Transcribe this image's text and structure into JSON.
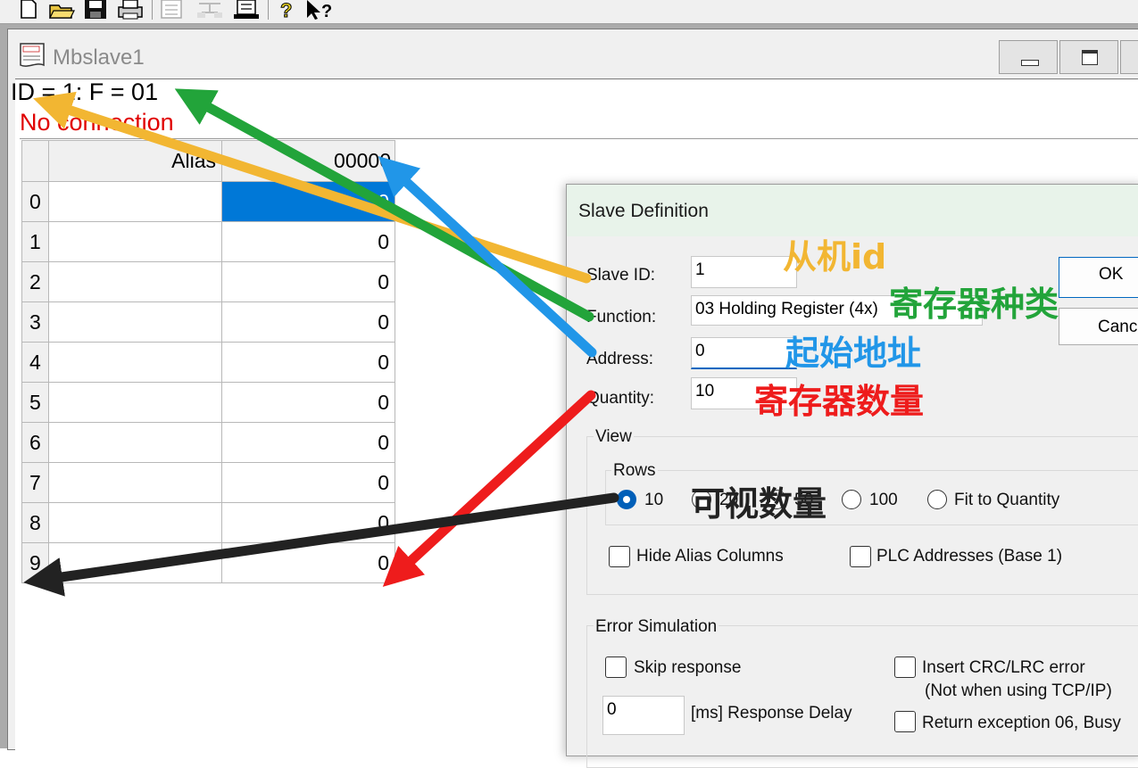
{
  "window": {
    "title": "Mbslave1"
  },
  "status": {
    "id_line": "ID = 1: F = 01",
    "connection": "No connection"
  },
  "grid": {
    "header_alias": "Alias",
    "header_address": "00000",
    "rows": [
      {
        "index": "0",
        "value": "0"
      },
      {
        "index": "1",
        "value": "0"
      },
      {
        "index": "2",
        "value": "0"
      },
      {
        "index": "3",
        "value": "0"
      },
      {
        "index": "4",
        "value": "0"
      },
      {
        "index": "5",
        "value": "0"
      },
      {
        "index": "6",
        "value": "0"
      },
      {
        "index": "7",
        "value": "0"
      },
      {
        "index": "8",
        "value": "0"
      },
      {
        "index": "9",
        "value": "0"
      }
    ]
  },
  "dialog": {
    "title": "Slave Definition",
    "slave_id_label": "Slave ID:",
    "slave_id_value": "1",
    "function_label": "Function:",
    "function_value": "03 Holding Register (4x)",
    "address_label": "Address:",
    "address_value": "0",
    "quantity_label": "Quantity:",
    "quantity_value": "10",
    "ok_label": "OK",
    "cancel_label": "Canc",
    "view_label": "View",
    "rows_label": "Rows",
    "row_options": [
      "10",
      "20",
      "50",
      "100",
      "Fit to Quantity"
    ],
    "row_selected": "10",
    "hide_alias_label": "Hide Alias Columns",
    "plc_addresses_label": "PLC Addresses (Base 1)",
    "error_sim_label": "Error Simulation",
    "skip_response_label": "Skip response",
    "insert_crc_label": "Insert CRC/LRC error",
    "not_tcp_label": "(Not when using TCP/IP)",
    "response_delay_value": "0",
    "response_delay_label": "[ms] Response Delay",
    "return_exception_label": "Return exception 06, Busy"
  },
  "annotations": {
    "slave_id": {
      "text": "从机id",
      "color": "#f2b632"
    },
    "function": {
      "text": "寄存器种类",
      "color": "#22a43a"
    },
    "address": {
      "text": "起始地址",
      "color": "#2196e8"
    },
    "quantity": {
      "text": "寄存器数量",
      "color": "#ee1c1c"
    },
    "rows": {
      "text": "可视数量",
      "color": "#222222"
    }
  }
}
